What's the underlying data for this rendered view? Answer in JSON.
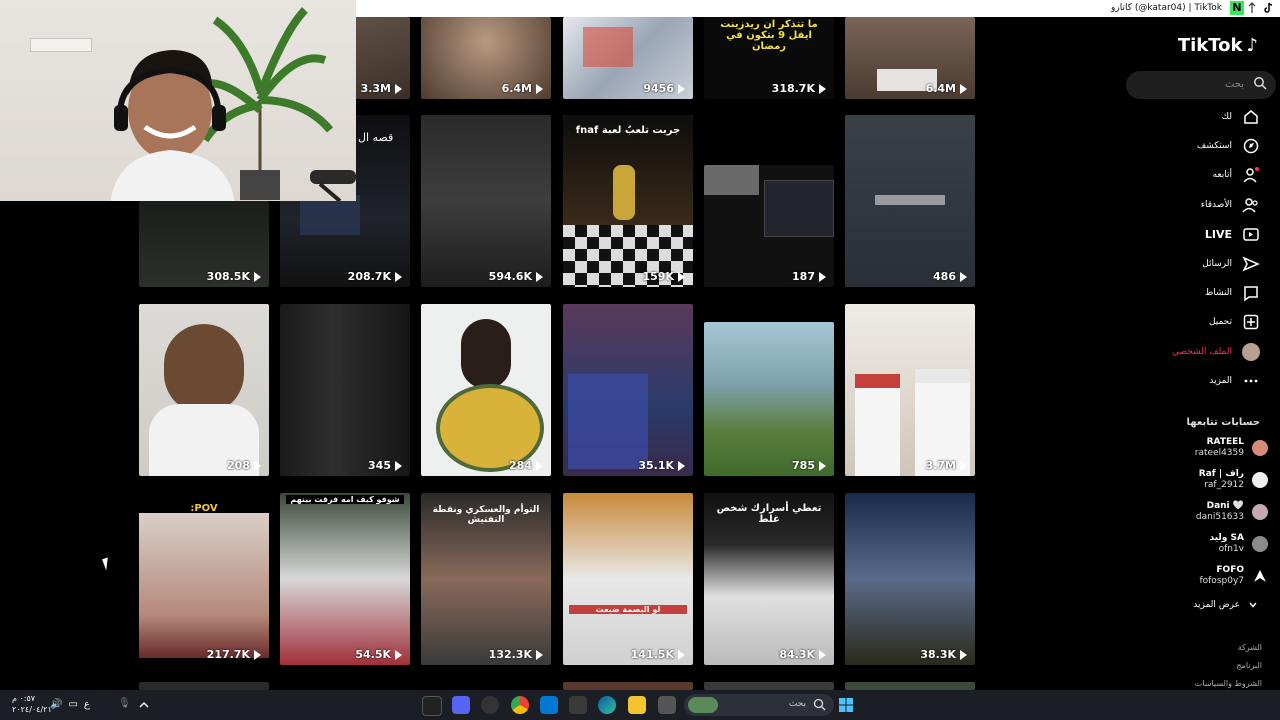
{
  "window": {
    "title": "كاتارو (@katar04) | TikTok"
  },
  "sidebar": {
    "logo": "TikTok",
    "search_placeholder": "بحث",
    "nav": [
      {
        "label": "لك",
        "icon": "home-icon"
      },
      {
        "label": "استكشف",
        "icon": "compass-icon"
      },
      {
        "label": "أتابعه",
        "icon": "following-icon"
      },
      {
        "label": "الأصدقاء",
        "icon": "friends-icon"
      },
      {
        "label": "LIVE",
        "icon": "live-icon"
      },
      {
        "label": "الرسائل",
        "icon": "messages-icon"
      },
      {
        "label": "النشاط",
        "icon": "activity-icon"
      },
      {
        "label": "تحميل",
        "icon": "upload-icon"
      },
      {
        "label": "الملف الشخصي",
        "icon": "profile-avatar-icon"
      },
      {
        "label": "المزيد",
        "icon": "more-icon"
      }
    ],
    "following_title": "حسابات تتابعها",
    "accounts": [
      {
        "display": "RATEEL",
        "username": "rateel4359",
        "color": "#d88a7a"
      },
      {
        "display": "Raf | راف",
        "username": "raf_2912",
        "color": "#eeeeee"
      },
      {
        "display": "Dani 🤍",
        "username": "dani51633",
        "color": "#c5a8b0"
      },
      {
        "display": "وليد SA",
        "username": "ofn1v",
        "color": "#8b8b8b"
      },
      {
        "display": "FOFO",
        "username": "fofosp0y7",
        "color": "#444444"
      }
    ],
    "see_more": "عرض المزيد",
    "footer": [
      "الشركة",
      "البرنامج",
      "الشروط والسياسات"
    ]
  },
  "videos": [
    {
      "views": "3.3M"
    },
    {
      "views": "6.4M"
    },
    {
      "views": "9456"
    },
    {
      "views": "318.7K",
      "caption": "ما تتذكر ان ريدزينت ايفل 9 بتكون في رمضان"
    },
    {
      "views": "6.4M"
    },
    {
      "views": "308.5K"
    },
    {
      "views": "208.7K"
    },
    {
      "views": "594.6K"
    },
    {
      "views": "159K",
      "caption": "جربت تلعبٌ لعبة fnaf"
    },
    {
      "views": "187"
    },
    {
      "views": "486"
    },
    {
      "views": "208"
    },
    {
      "views": "345"
    },
    {
      "views": "284"
    },
    {
      "views": "35.1K"
    },
    {
      "views": "785"
    },
    {
      "views": "3.7M"
    },
    {
      "views": "217.7K",
      "caption": "POV:"
    },
    {
      "views": "54.5K",
      "caption": "شوفو كيف امه فرقت بينهم"
    },
    {
      "views": "132.3K",
      "caption": "التوأم والعسكري ونقطة التفتيش"
    },
    {
      "views": "141.5K",
      "caption": "لو البصمة ضبعت"
    },
    {
      "views": "84.3K",
      "caption": "تعطي أسرارك شخص غلط"
    },
    {
      "views": "38.3K"
    }
  ],
  "webcam_overlay_text": "قصه ال",
  "taskbar": {
    "search_placeholder": "بحث",
    "time": "٠:٥٧ م",
    "date": "٢٠٢٤/٠٤/٢١",
    "lang": "ع"
  }
}
